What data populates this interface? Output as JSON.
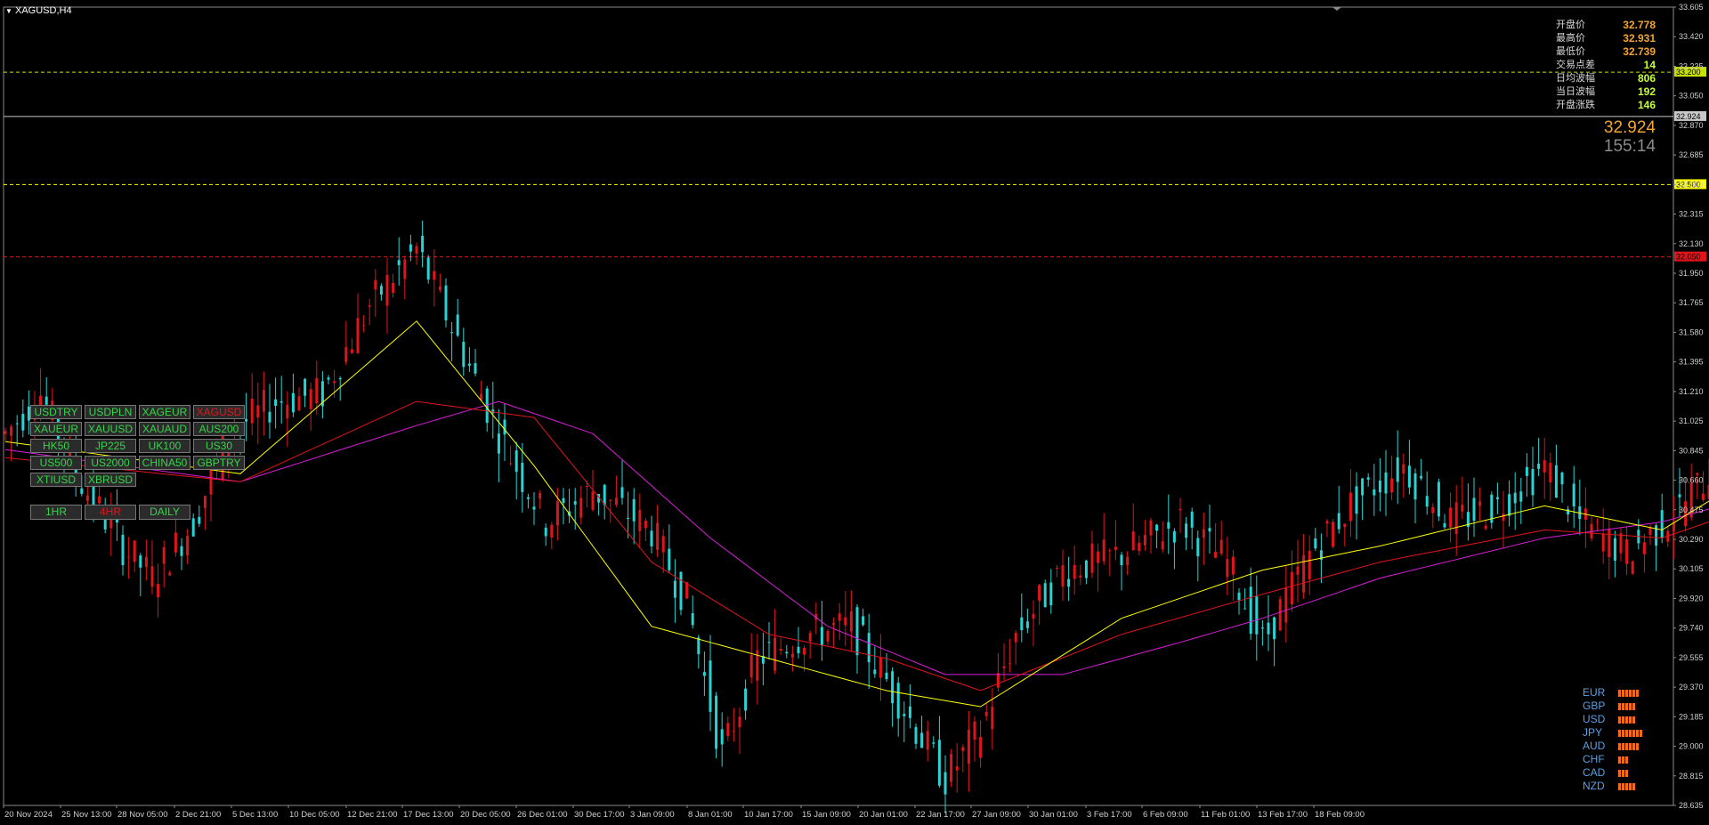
{
  "symbol": "XAGUSD,H4",
  "colors": {
    "background": "#000000",
    "bull": "#e0151b",
    "bear": "#27d3d3",
    "ma_fast": "#ffff00",
    "ma_mid": "#e0151b",
    "ma_slow": "#d91ed9",
    "zone": "#0000ff",
    "arrow": "#f2a531",
    "level_green": "#c8e000",
    "level_yellow": "#ffff00",
    "level_red": "#e0151b"
  },
  "info_panel": [
    {
      "label": "开盘价",
      "value": "32.778",
      "color": "#f2a531"
    },
    {
      "label": "最高价",
      "value": "32.931",
      "color": "#f2a531"
    },
    {
      "label": "最低价",
      "value": "32.739",
      "color": "#f2a531"
    },
    {
      "label": "交易点差",
      "value": "14",
      "color": "#c8ff32"
    },
    {
      "label": "日均波幅",
      "value": "806",
      "color": "#c8ff32"
    },
    {
      "label": "当日波幅",
      "value": "192",
      "color": "#c8ff32"
    },
    {
      "label": "开盘涨跌",
      "value": "146",
      "color": "#c8ff32"
    }
  ],
  "big_price": "32.924",
  "countdown": "155:14",
  "symbol_buttons": [
    [
      "USDTRY",
      "USDPLN",
      "XAGEUR",
      "XAGUSD"
    ],
    [
      "XAUEUR",
      "XAUUSD",
      "XAUAUD",
      "AUS200"
    ],
    [
      "HK50",
      "JP225",
      "UK100",
      "US30"
    ],
    [
      "US500",
      "US2000",
      "CHINA50",
      "GBPTRY"
    ],
    [
      "XTIUSD",
      "XBRUSD"
    ]
  ],
  "active_symbol": "XAGUSD",
  "timeframe_buttons": [
    "1HR",
    "4HR",
    "DAILY"
  ],
  "active_timeframe": "4HR",
  "currency_strength": [
    {
      "name": "EUR",
      "bars": 6
    },
    {
      "name": "GBP",
      "bars": 5
    },
    {
      "name": "USD",
      "bars": 5
    },
    {
      "name": "JPY",
      "bars": 7
    },
    {
      "name": "AUD",
      "bars": 6
    },
    {
      "name": "CHF",
      "bars": 3
    },
    {
      "name": "CAD",
      "bars": 3
    },
    {
      "name": "NZD",
      "bars": 5
    }
  ],
  "chart_data": {
    "type": "candlestick",
    "title": "XAGUSD,H4",
    "ylim": [
      28.635,
      33.605
    ],
    "y_ticks": [
      "33.605",
      "33.420",
      "33.235",
      "33.050",
      "32.870",
      "32.685",
      "32.500",
      "32.315",
      "32.130",
      "31.950",
      "31.765",
      "31.580",
      "31.395",
      "31.210",
      "31.025",
      "30.845",
      "30.660",
      "30.475",
      "30.290",
      "30.105",
      "29.920",
      "29.740",
      "29.555",
      "29.370",
      "29.185",
      "29.000",
      "28.815",
      "28.635"
    ],
    "x_ticks": [
      "20 Nov 2024",
      "25 Nov 13:00",
      "28 Nov 05:00",
      "2 Dec 21:00",
      "5 Dec 13:00",
      "10 Dec 05:00",
      "12 Dec 21:00",
      "17 Dec 13:00",
      "20 Dec 05:00",
      "26 Dec 01:00",
      "30 Dec 17:00",
      "3 Jan 09:00",
      "8 Jan 01:00",
      "10 Jan 17:00",
      "15 Jan 09:00",
      "20 Jan 01:00",
      "22 Jan 17:00",
      "27 Jan 09:00",
      "30 Jan 01:00",
      "3 Feb 17:00",
      "6 Feb 09:00",
      "11 Feb 01:00",
      "13 Feb 17:00",
      "18 Feb 09:00"
    ],
    "anchors": [
      [
        0,
        30.95
      ],
      [
        6,
        31.2
      ],
      [
        12,
        30.7
      ],
      [
        20,
        30.25
      ],
      [
        25,
        30.05
      ],
      [
        32,
        30.4
      ],
      [
        38,
        30.95
      ],
      [
        46,
        31.15
      ],
      [
        54,
        31.2
      ],
      [
        62,
        31.75
      ],
      [
        70,
        32.1
      ],
      [
        78,
        31.45
      ],
      [
        84,
        30.95
      ],
      [
        92,
        30.4
      ],
      [
        100,
        30.6
      ],
      [
        110,
        30.35
      ],
      [
        116,
        29.9
      ],
      [
        122,
        28.95
      ],
      [
        128,
        29.55
      ],
      [
        136,
        29.7
      ],
      [
        144,
        29.75
      ],
      [
        152,
        29.3
      ],
      [
        160,
        28.8
      ],
      [
        166,
        29.1
      ],
      [
        172,
        29.7
      ],
      [
        180,
        30.1
      ],
      [
        190,
        30.2
      ],
      [
        200,
        30.4
      ],
      [
        208,
        30.15
      ],
      [
        214,
        29.65
      ],
      [
        222,
        30.2
      ],
      [
        230,
        30.55
      ],
      [
        238,
        30.75
      ],
      [
        246,
        30.4
      ],
      [
        254,
        30.5
      ],
      [
        262,
        30.75
      ],
      [
        268,
        30.4
      ],
      [
        276,
        30.2
      ],
      [
        284,
        30.45
      ],
      [
        290,
        30.7
      ],
      [
        296,
        30.95
      ],
      [
        302,
        31.5
      ],
      [
        308,
        31.25
      ],
      [
        314,
        31.55
      ],
      [
        320,
        31.7
      ],
      [
        326,
        32.2
      ],
      [
        334,
        32.15
      ],
      [
        340,
        31.95
      ],
      [
        346,
        32.35
      ],
      [
        352,
        31.95
      ],
      [
        358,
        31.85
      ],
      [
        364,
        32.0
      ],
      [
        370,
        32.45
      ],
      [
        375,
        33.35
      ],
      [
        379,
        32.45
      ],
      [
        384,
        32.3
      ],
      [
        390,
        32.9
      ]
    ],
    "ma_fast": [
      [
        0,
        30.9
      ],
      [
        40,
        30.7
      ],
      [
        70,
        31.65
      ],
      [
        90,
        30.75
      ],
      [
        110,
        29.75
      ],
      [
        130,
        29.55
      ],
      [
        150,
        29.35
      ],
      [
        166,
        29.25
      ],
      [
        190,
        29.8
      ],
      [
        214,
        30.1
      ],
      [
        234,
        30.25
      ],
      [
        262,
        30.5
      ],
      [
        282,
        30.35
      ],
      [
        302,
        30.8
      ],
      [
        322,
        31.7
      ],
      [
        340,
        32.15
      ],
      [
        352,
        32.0
      ],
      [
        370,
        31.95
      ],
      [
        384,
        32.25
      ],
      [
        390,
        32.4
      ]
    ],
    "ma_mid": [
      [
        0,
        30.8
      ],
      [
        40,
        30.65
      ],
      [
        70,
        31.15
      ],
      [
        90,
        31.05
      ],
      [
        110,
        30.15
      ],
      [
        130,
        29.7
      ],
      [
        150,
        29.55
      ],
      [
        166,
        29.35
      ],
      [
        190,
        29.7
      ],
      [
        214,
        29.95
      ],
      [
        234,
        30.15
      ],
      [
        262,
        30.35
      ],
      [
        282,
        30.3
      ],
      [
        302,
        30.55
      ],
      [
        322,
        31.3
      ],
      [
        340,
        31.75
      ],
      [
        352,
        31.85
      ],
      [
        370,
        31.95
      ],
      [
        384,
        32.05
      ],
      [
        390,
        32.2
      ]
    ],
    "ma_slow": [
      [
        0,
        30.85
      ],
      [
        40,
        30.65
      ],
      [
        70,
        31.0
      ],
      [
        84,
        31.15
      ],
      [
        100,
        30.95
      ],
      [
        120,
        30.3
      ],
      [
        140,
        29.75
      ],
      [
        160,
        29.45
      ],
      [
        180,
        29.45
      ],
      [
        200,
        29.65
      ],
      [
        214,
        29.8
      ],
      [
        234,
        30.05
      ],
      [
        262,
        30.3
      ],
      [
        282,
        30.4
      ],
      [
        302,
        30.6
      ],
      [
        322,
        30.95
      ],
      [
        340,
        31.4
      ],
      [
        352,
        31.7
      ],
      [
        370,
        31.95
      ],
      [
        384,
        32.0
      ],
      [
        390,
        32.1
      ]
    ],
    "levels": [
      {
        "price": 33.2,
        "label": "33.200",
        "color": "#c8e000",
        "dashed": true
      },
      {
        "price": 32.924,
        "label": "32.924",
        "color": "#c8c8c8",
        "dashed": false
      },
      {
        "price": 32.5,
        "label": "32.500",
        "color": "#ffff00",
        "dashed": true
      },
      {
        "price": 32.05,
        "label": "32.050",
        "color": "#e0151b",
        "dashed": true
      }
    ],
    "zone": {
      "x_from": 377,
      "x_to": 418,
      "y_low": 32.5,
      "y_high": 33.2
    },
    "arrow": {
      "start": [
        386,
        32.84
      ],
      "mid": [
        393,
        32.55
      ],
      "end": [
        410,
        33.15
      ]
    }
  }
}
